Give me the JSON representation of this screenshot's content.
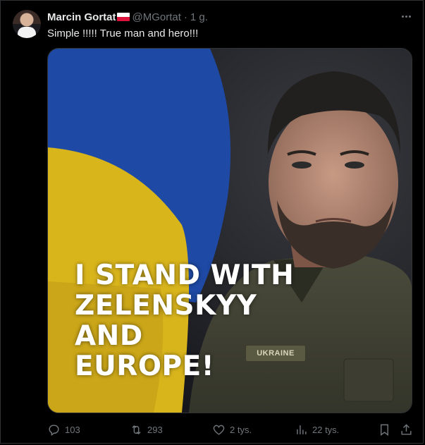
{
  "tweet": {
    "author_name": "Marcin Gortat",
    "handle": "@MGortat",
    "separator": "·",
    "time": "1 g.",
    "text": "Simple !!!!! True man and hero!!!"
  },
  "media": {
    "overlay_lines": [
      "I STAND WITH",
      "ZELENSKYY",
      "AND",
      "EUROPE!"
    ],
    "badge_text": "UKRAINE"
  },
  "actions": {
    "replies": "103",
    "retweets": "293",
    "likes": "2 tys.",
    "views": "22 tys."
  },
  "colors": {
    "background": "#000000",
    "text": "#e7e9ea",
    "muted": "#71767b",
    "border": "#2f3336",
    "flag_blue": "#1f4fae",
    "flag_yellow": "#e8c21a"
  }
}
